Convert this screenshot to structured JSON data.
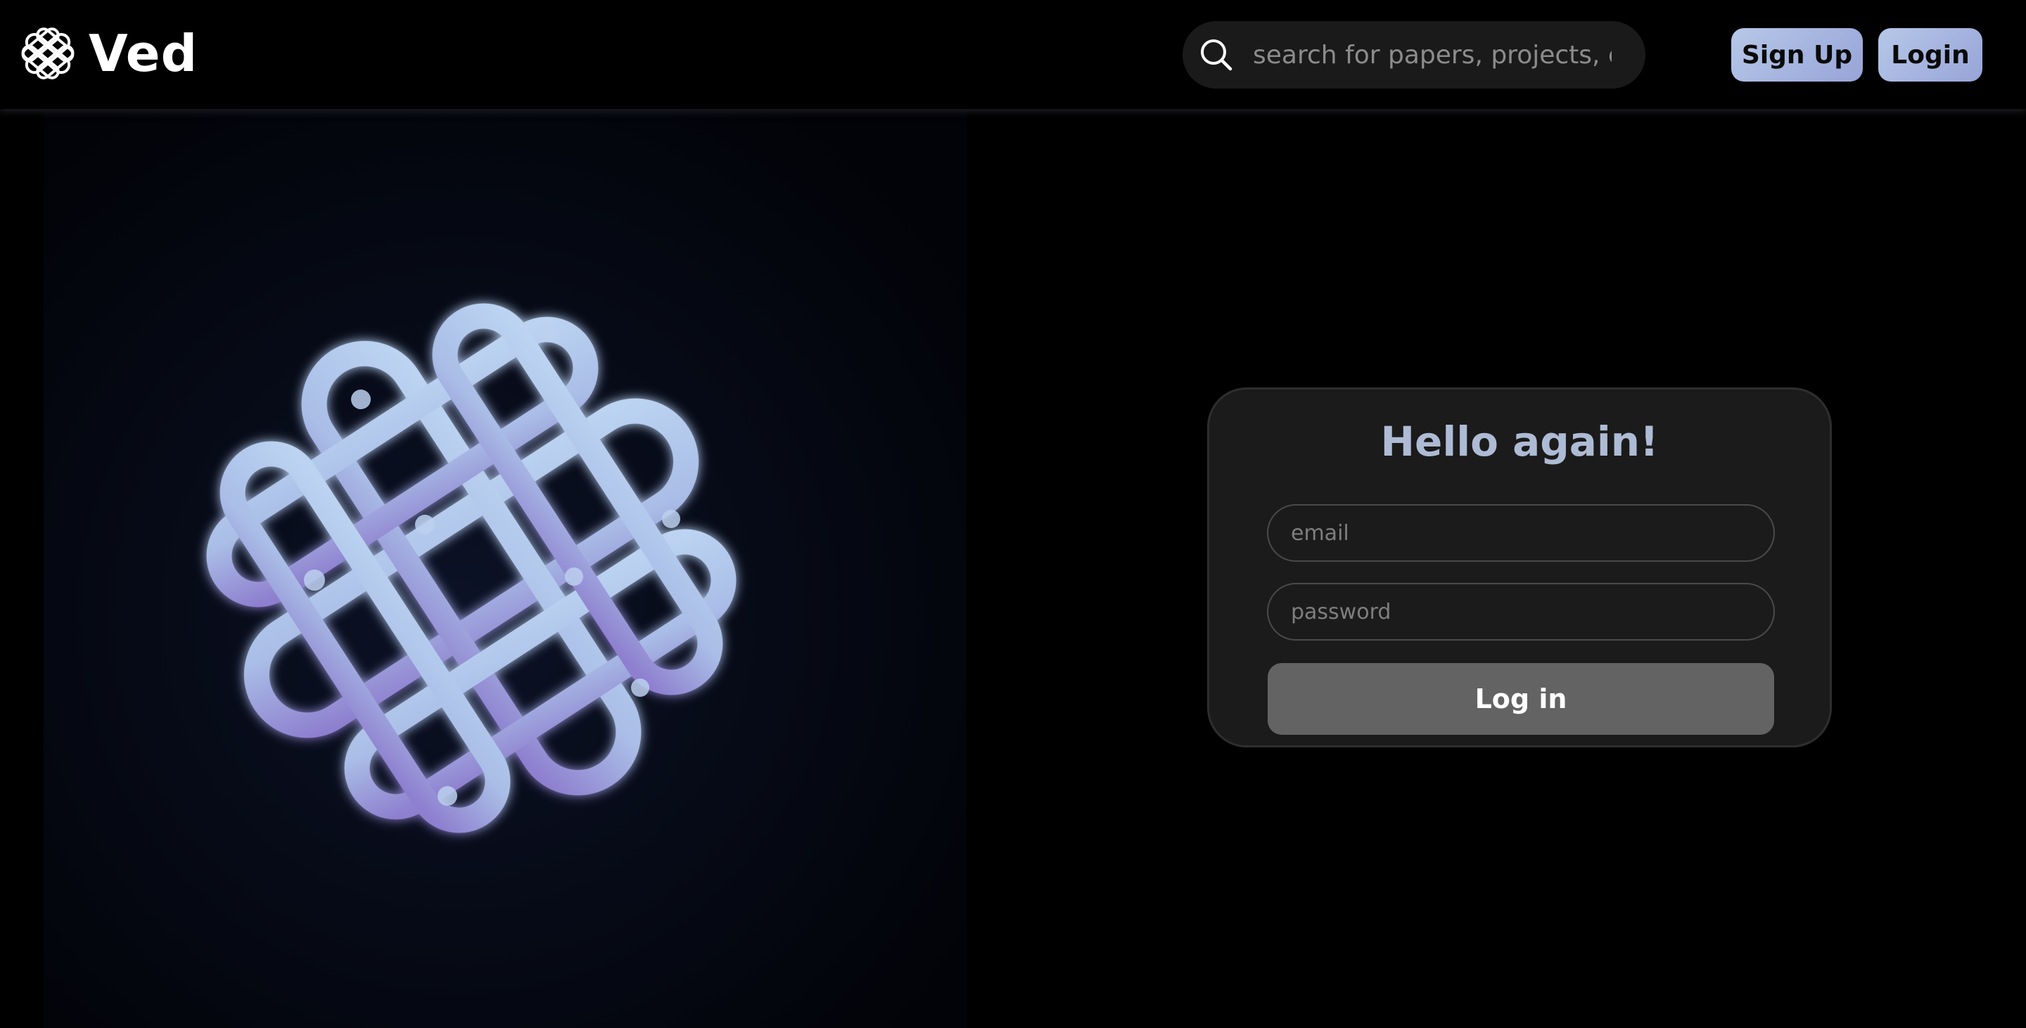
{
  "header": {
    "brand_name": "Ved",
    "logo_icon": "endless-knot-icon",
    "search": {
      "placeholder": "search for papers, projects, etc",
      "icon": "search-icon"
    },
    "signup_label": "Sign Up",
    "login_label": "Login"
  },
  "hero": {
    "art_icon": "endless-knot-icon"
  },
  "login_card": {
    "title": "Hello again!",
    "email_placeholder": "email",
    "password_placeholder": "password",
    "submit_label": "Log in"
  },
  "colors": {
    "background": "#000000",
    "accent_gradient_start": "#b6c8e8",
    "accent_gradient_end": "#97a4d8",
    "card_bg": "#1b1b1b",
    "title": "#aebbd4",
    "submit_bg": "#636363"
  }
}
